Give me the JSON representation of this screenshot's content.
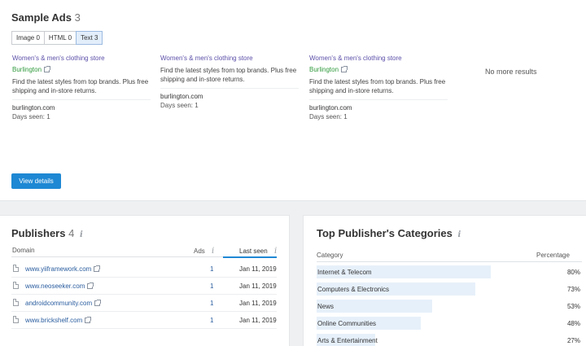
{
  "sample_ads": {
    "title": "Sample Ads",
    "count": "3",
    "filters": [
      {
        "label": "Image 0"
      },
      {
        "label": "HTML 0"
      },
      {
        "label": "Text 3"
      }
    ],
    "ads": [
      {
        "headline": "Women's & men's clothing store",
        "brand": "Burlington",
        "description": "Find the latest styles from top brands. Plus free shipping and in-store returns.",
        "domain": "burlington.com",
        "days_seen": "Days seen: 1"
      },
      {
        "headline": "Women's & men's clothing store",
        "brand": "",
        "description": "Find the latest styles from top brands. Plus free shipping and in-store returns.",
        "domain": "burlington.com",
        "days_seen": "Days seen: 1"
      },
      {
        "headline": "Women's & men's clothing store",
        "brand": "Burlington",
        "description": "Find the latest styles from top brands. Plus free shipping and in-store returns.",
        "domain": "burlington.com",
        "days_seen": "Days seen: 1"
      }
    ],
    "no_more": "No more results",
    "view_details": "View details"
  },
  "publishers": {
    "title": "Publishers",
    "count": "4",
    "info": "i",
    "headers": {
      "domain": "Domain",
      "ads": "Ads",
      "last_seen": "Last seen"
    },
    "rows": [
      {
        "domain": "www.yiiframework.com",
        "ads": "1",
        "last_seen": "Jan 11, 2019"
      },
      {
        "domain": "www.neoseeker.com",
        "ads": "1",
        "last_seen": "Jan 11, 2019"
      },
      {
        "domain": "androidcommunity.com",
        "ads": "1",
        "last_seen": "Jan 11, 2019"
      },
      {
        "domain": "www.brickshelf.com",
        "ads": "1",
        "last_seen": "Jan 11, 2019"
      }
    ]
  },
  "categories": {
    "title": "Top Publisher's Categories",
    "info": "i",
    "headers": {
      "category": "Category",
      "percentage": "Percentage"
    },
    "rows": [
      {
        "name": "Internet & Telecom",
        "pct": "80%",
        "value": 80
      },
      {
        "name": "Computers & Electronics",
        "pct": "73%",
        "value": 73
      },
      {
        "name": "News",
        "pct": "53%",
        "value": 53
      },
      {
        "name": "Online Communities",
        "pct": "48%",
        "value": 48
      },
      {
        "name": "Arts & Entertainment",
        "pct": "27%",
        "value": 27
      }
    ],
    "bar_color": "#e6f0fa"
  },
  "colors": {
    "accent": "#1e88d4",
    "link": "#2a5d9f",
    "ad_headline": "#5b4fa8",
    "ad_brand": "#2f9a3c"
  }
}
